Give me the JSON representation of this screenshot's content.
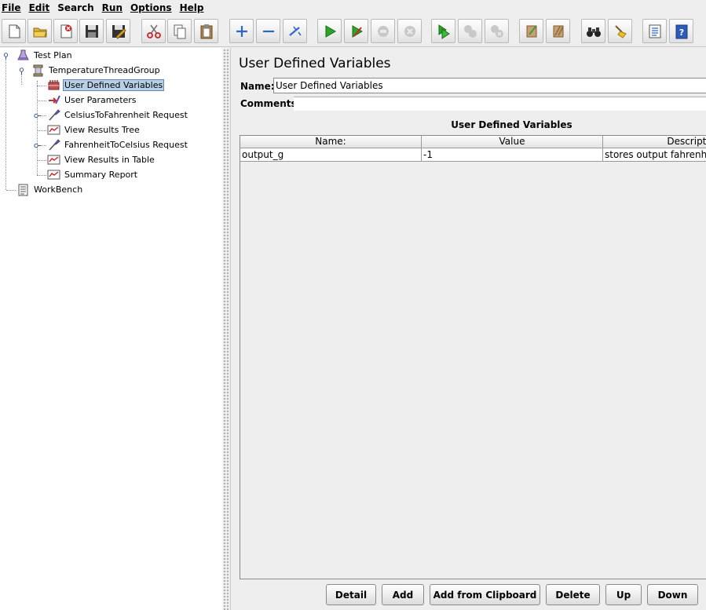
{
  "menu": [
    "File",
    "Edit",
    "Search",
    "Run",
    "Options",
    "Help"
  ],
  "tree": {
    "items": [
      "Test Plan",
      "TemperatureThreadGroup",
      "User Defined Variables",
      "User Parameters",
      "CelsiusToFahrenheit Request",
      "View Results Tree",
      "FahrenheitToCelsius Request",
      "View Results in Table",
      "Summary Report",
      "WorkBench"
    ],
    "selected": "User Defined Variables"
  },
  "panel": {
    "title": "User Defined Variables",
    "name_label": "Name:",
    "name_value": "User Defined Variables",
    "comments_label": "Comments:",
    "section_title": "User Defined Variables"
  },
  "table": {
    "headers": [
      "Name:",
      "Value",
      "Description"
    ],
    "rows": [
      [
        "output_g",
        "-1",
        "stores output fahrenheit"
      ]
    ]
  },
  "buttons": [
    "Detail",
    "Add",
    "Add from Clipboard",
    "Delete",
    "Up",
    "Down"
  ],
  "colors": {
    "selection": "#b8cfe5",
    "run_green": "#2aa52a"
  }
}
